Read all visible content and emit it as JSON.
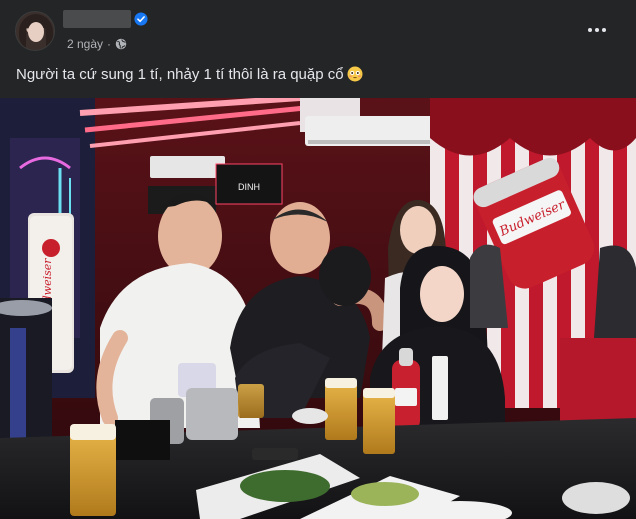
{
  "post": {
    "author_name": "",
    "verified": true,
    "time": "2 ngày",
    "privacy": "public",
    "text": "Người ta cứ sung 1 tí, nhảy 1 tí thôi là ra quặp cổ",
    "emoji": "flushed-face",
    "photo_signs": {
      "bar_sign": "DINH",
      "can_brand": "Budweiser",
      "tower_brand": "Budweiser"
    }
  },
  "colors": {
    "background": "#242526",
    "text_primary": "#e4e6eb",
    "text_secondary": "#b0b3b8",
    "verified_blue": "#1877f2"
  },
  "icons": {
    "verified": "verified-badge-icon",
    "privacy": "globe-icon",
    "more": "more-options-icon"
  }
}
